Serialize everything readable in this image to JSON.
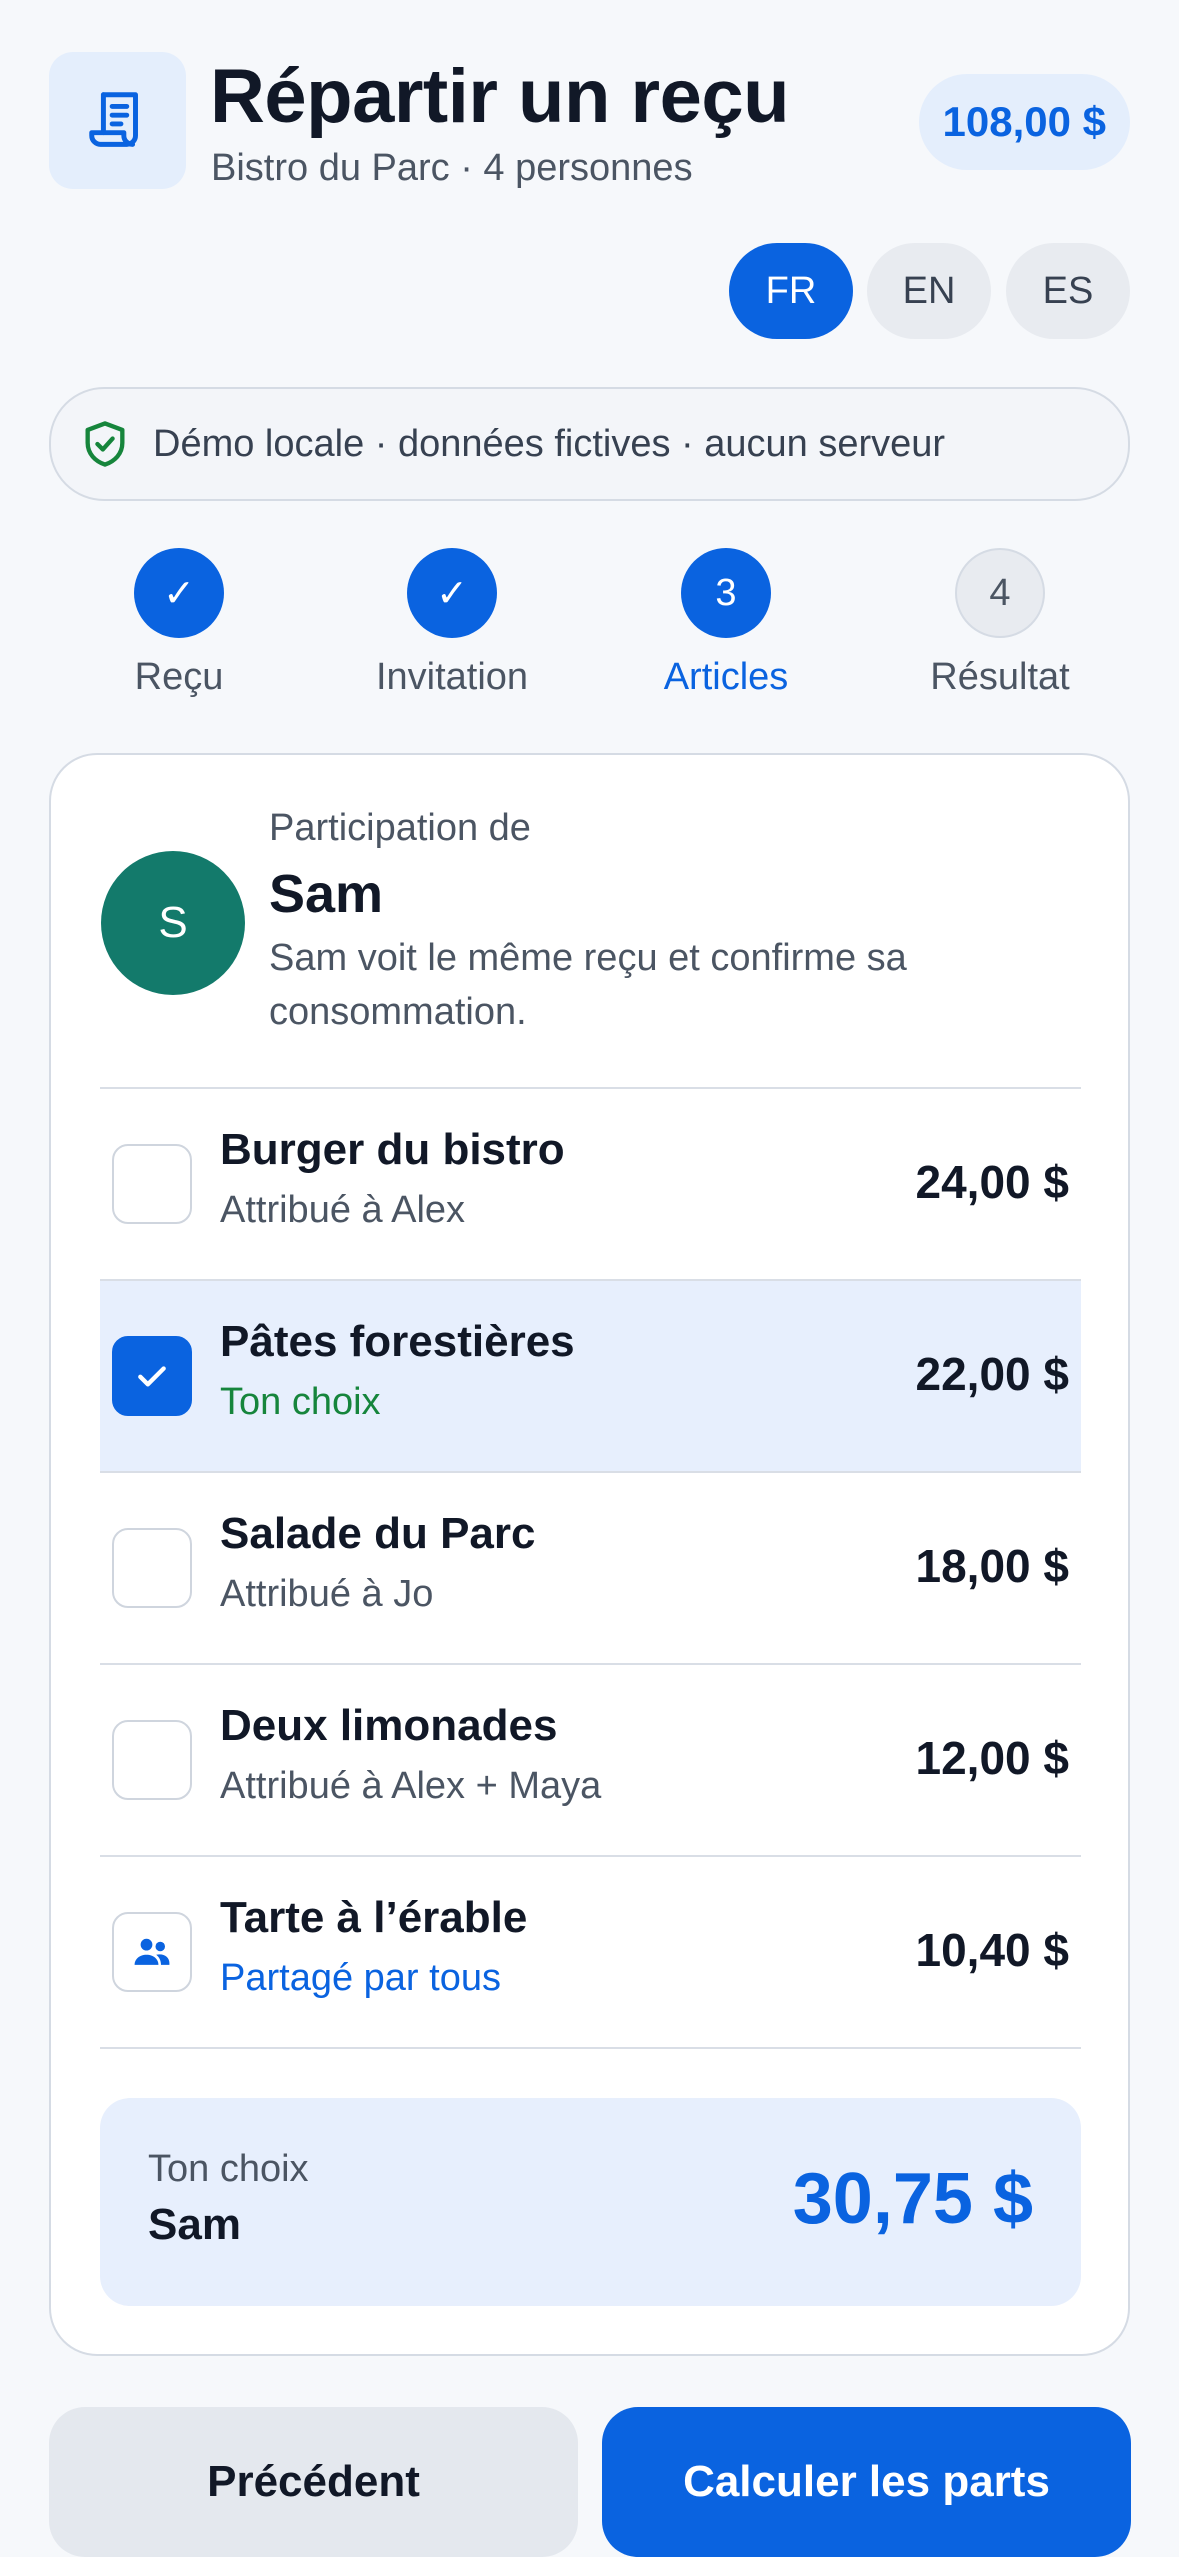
{
  "header": {
    "title": "Répartir un reçu",
    "subtitle": "Bistro du Parc · 4 personnes",
    "total": "108,00 $",
    "icon": "receipt-icon"
  },
  "languages": [
    {
      "code": "FR",
      "active": true
    },
    {
      "code": "EN",
      "active": false
    },
    {
      "code": "ES",
      "active": false
    }
  ],
  "notice": {
    "text": "Démo locale · données fictives · aucun serveur",
    "icon": "shield-check-icon"
  },
  "steps": [
    {
      "label": "Reçu",
      "marker": "✓",
      "state": "done"
    },
    {
      "label": "Invitation",
      "marker": "✓",
      "state": "done"
    },
    {
      "label": "Articles",
      "marker": "3",
      "state": "current"
    },
    {
      "label": "Résultat",
      "marker": "4",
      "state": "todo"
    }
  ],
  "participant": {
    "kicker": "Participation de",
    "name": "Sam",
    "initial": "S",
    "description": "Sam voit le même reçu et confirme sa consommation."
  },
  "items": [
    {
      "name": "Burger du bistro",
      "sub": "Attribué à Alex",
      "price": "24,00 $",
      "checked": false
    },
    {
      "name": "Pâtes forestières",
      "sub": "Ton choix",
      "price": "22,00 $",
      "checked": true
    },
    {
      "name": "Salade du Parc",
      "sub": "Attribué à Jo",
      "price": "18,00 $",
      "checked": false
    },
    {
      "name": "Deux limonades",
      "sub": "Attribué à Alex + Maya",
      "price": "12,00 $",
      "checked": false
    },
    {
      "name": "Tarte à l’érable",
      "sub": "Partagé par tous",
      "price": "10,40 $",
      "checked": false,
      "shared": true
    }
  ],
  "summary": {
    "kicker": "Ton choix",
    "name": "Sam",
    "amount": "30,75 $"
  },
  "actions": {
    "back": "Précédent",
    "next": "Calculer les parts"
  },
  "colors": {
    "accent": "#0a63e0",
    "avatar": "#137a6b",
    "success": "#16853c",
    "selected_bg": "#e7effd"
  }
}
